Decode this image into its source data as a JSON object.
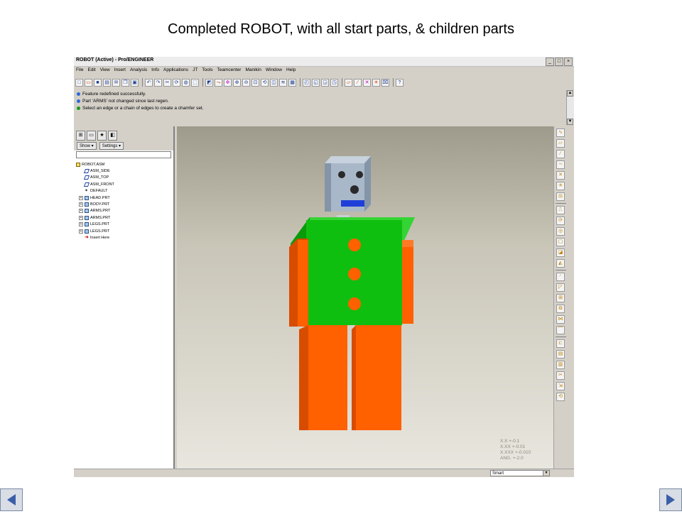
{
  "slide": {
    "title": "Completed ROBOT, with all start parts, & children parts"
  },
  "window": {
    "title": "ROBOT (Active) - Pro/ENGINEER",
    "controls": [
      "_",
      "□",
      "×"
    ]
  },
  "menu": [
    "File",
    "Edit",
    "View",
    "Insert",
    "Analysis",
    "Info",
    "Applications",
    "JT",
    "Tools",
    "Teamcenter",
    "Manikin",
    "Window",
    "Help"
  ],
  "toolbar_icons": [
    "new-icon",
    "open-icon",
    "save-icon",
    "print-icon",
    "email-icon",
    "copy-icon",
    "paste-icon",
    "undo-icon",
    "redo-icon",
    "cut-icon",
    "regenerate-icon",
    "find-icon",
    "select-box-icon",
    "repaint-icon",
    "orient-icon",
    "spin-icon",
    "zoom-in-icon",
    "zoom-out-icon",
    "refit-icon",
    "reorient-icon",
    "saved-views-icon",
    "layers-icon",
    "view-manager-icon",
    "wireframe-icon",
    "hidden-line-icon",
    "no-hidden-icon",
    "shading-icon",
    "datum-planes-icon",
    "datum-axes-icon",
    "datum-points-icon",
    "coordinate-systems-icon",
    "annotations-icon",
    "context-help-icon"
  ],
  "messages": [
    {
      "text": "Feature redefined successfully.",
      "color": "#2a6ad8"
    },
    {
      "text": "Part 'ARMS' not changed since last regen.",
      "color": "#2a6ad8"
    },
    {
      "text": "Select an edge or a chain of edges to create a chamfer set.",
      "color": "#1b9a1b"
    }
  ],
  "navigator": {
    "tabs": [
      "model-tree-tab",
      "folder-browser-tab",
      "favorites-tab",
      "connections-tab"
    ],
    "show_label": "Show ▾",
    "settings_label": "Settings ▾",
    "tree": [
      {
        "label": "ROBOT.ASM",
        "icon": "assembly-icon",
        "indent": 0,
        "expandable": false
      },
      {
        "label": "ASM_SIDE",
        "icon": "datum-plane-icon",
        "indent": 1,
        "expandable": false
      },
      {
        "label": "ASM_TOP",
        "icon": "datum-plane-icon",
        "indent": 1,
        "expandable": false
      },
      {
        "label": "ASM_FRONT",
        "icon": "datum-plane-icon",
        "indent": 1,
        "expandable": false
      },
      {
        "label": "DEFAULT",
        "icon": "coordinate-system-icon",
        "indent": 1,
        "expandable": false
      },
      {
        "label": "HEAD.PRT",
        "icon": "part-icon",
        "indent": 1,
        "expandable": true
      },
      {
        "label": "BODY.PRT",
        "icon": "part-icon",
        "indent": 1,
        "expandable": true
      },
      {
        "label": "ARMS.PRT",
        "icon": "part-icon",
        "indent": 1,
        "expandable": true
      },
      {
        "label": "ARMS.PRT",
        "icon": "part-icon",
        "indent": 1,
        "expandable": true
      },
      {
        "label": "LEGS.PRT",
        "icon": "part-icon",
        "indent": 1,
        "expandable": true
      },
      {
        "label": "LEGS.PRT",
        "icon": "part-icon",
        "indent": 1,
        "expandable": true
      },
      {
        "label": "Insert Here",
        "icon": "insert-arrow-icon",
        "indent": 1,
        "expandable": false
      }
    ]
  },
  "model_colors": {
    "head": "#a9b8c9",
    "body": "#0fbf0f",
    "limbs": "#ff6000",
    "eyes": "#2a2a2a",
    "mouth": "#1f3fd8"
  },
  "tolerances": [
    "X.X +-0.1",
    "X.XX +-0.01",
    "X.XXX +-0.010",
    "ANG. +-2.0"
  ],
  "right_toolbar_icons": [
    "sketch-icon",
    "datum-plane-tool-icon",
    "datum-axis-tool-icon",
    "datum-curve-icon",
    "datum-point-icon",
    "csys-tool-icon",
    "analysis-tool-icon",
    "extrude-icon",
    "revolve-icon",
    "hole-icon",
    "shell-icon",
    "rib-icon",
    "draft-icon",
    "round-icon",
    "chamfer-icon",
    "pattern-icon",
    "mirror-icon",
    "merge-icon",
    "trim-icon",
    "offset-icon",
    "thicken-icon",
    "solidify-icon",
    "intersect-icon",
    "project-icon",
    "wrap-icon"
  ],
  "status": {
    "filter_value": "Smart"
  },
  "navigation": {
    "prev": "◀",
    "next": "▶"
  }
}
